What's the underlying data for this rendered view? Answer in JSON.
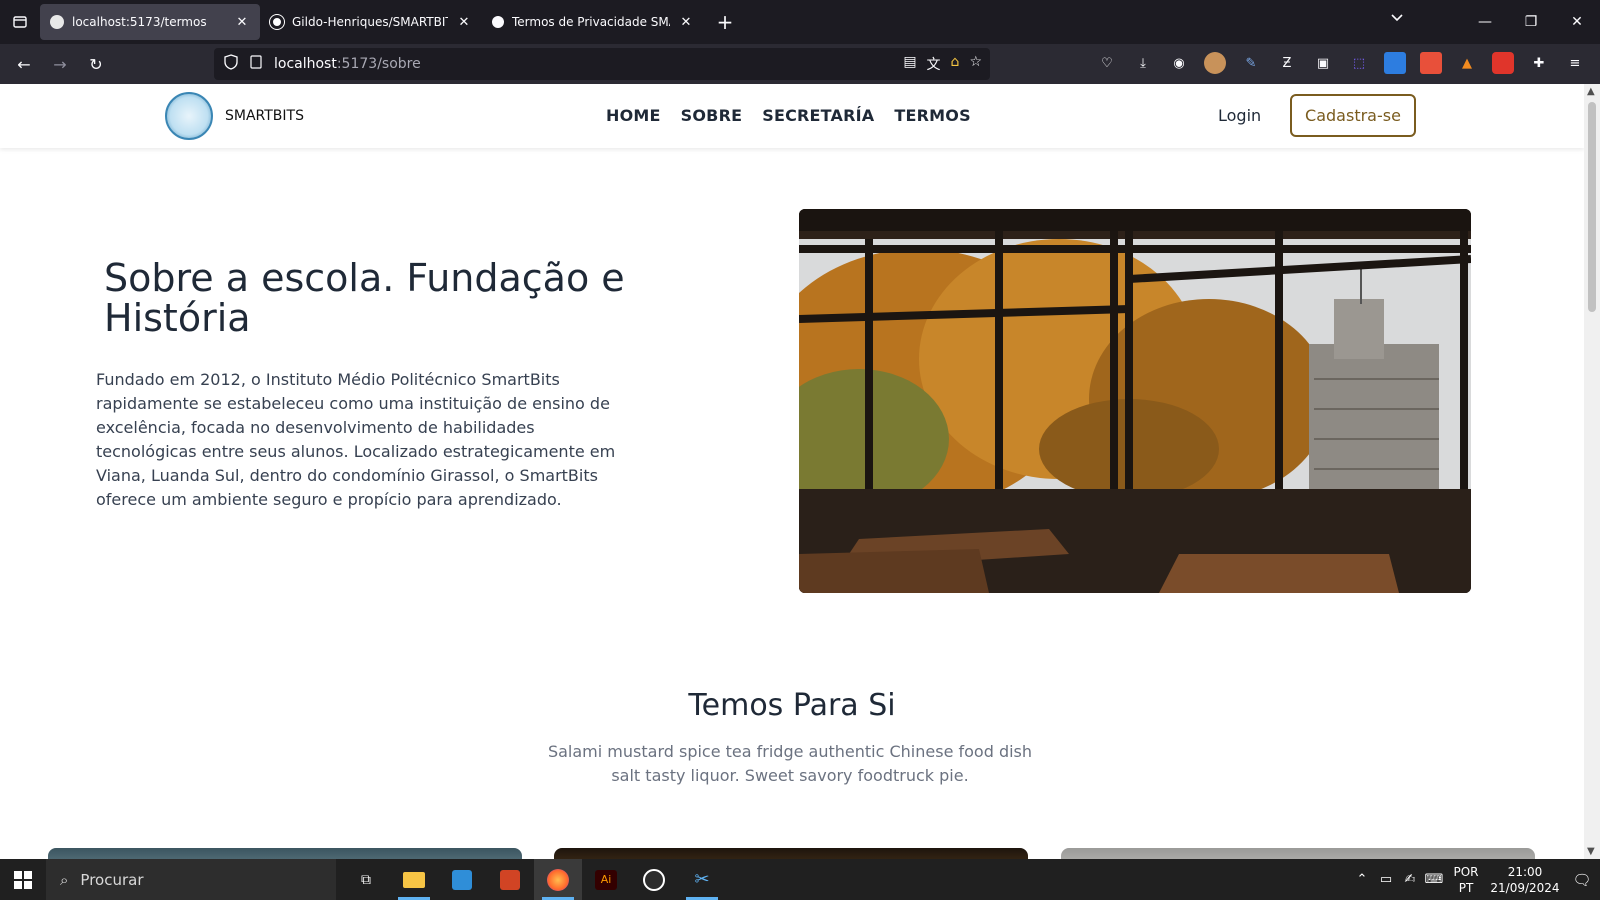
{
  "browser": {
    "tabs": [
      {
        "title": "localhost:5173/termos",
        "active": true
      },
      {
        "title": "Gildo-Henriques/SMARTBITS: P",
        "active": false
      },
      {
        "title": "Termos de Privacidade SMARTB",
        "active": false
      }
    ],
    "url_host": "localhost",
    "url_path": ":5173/sobre"
  },
  "site": {
    "brand": "SMARTBITS",
    "menu": [
      "HOME",
      "SOBRE",
      "SECRETARÍA",
      "TERMOS"
    ],
    "login": "Login",
    "signup": "Cadastra-se",
    "hero": {
      "title": "Sobre a escola. Fundação e História",
      "text": "Fundado em 2012, o Instituto Médio Politécnico SmartBits rapidamente se estabeleceu como uma instituição de ensino de excelência, focada no desenvolvimento de habilidades tecnológicas entre seus alunos. Localizado estrategicamente em Viana, Luanda Sul, dentro do condomínio Girassol, o SmartBits oferece um ambiente seguro e propício para aprendizado."
    },
    "section": {
      "title": "Temos Para Si",
      "subtitle": "Salami mustard spice tea fridge authentic Chinese food dish salt tasty liquor. Sweet savory foodtruck pie."
    }
  },
  "taskbar": {
    "search_placeholder": "Procurar",
    "lang_1": "POR",
    "lang_2": "PT",
    "time": "21:00",
    "date": "21/09/2024"
  }
}
